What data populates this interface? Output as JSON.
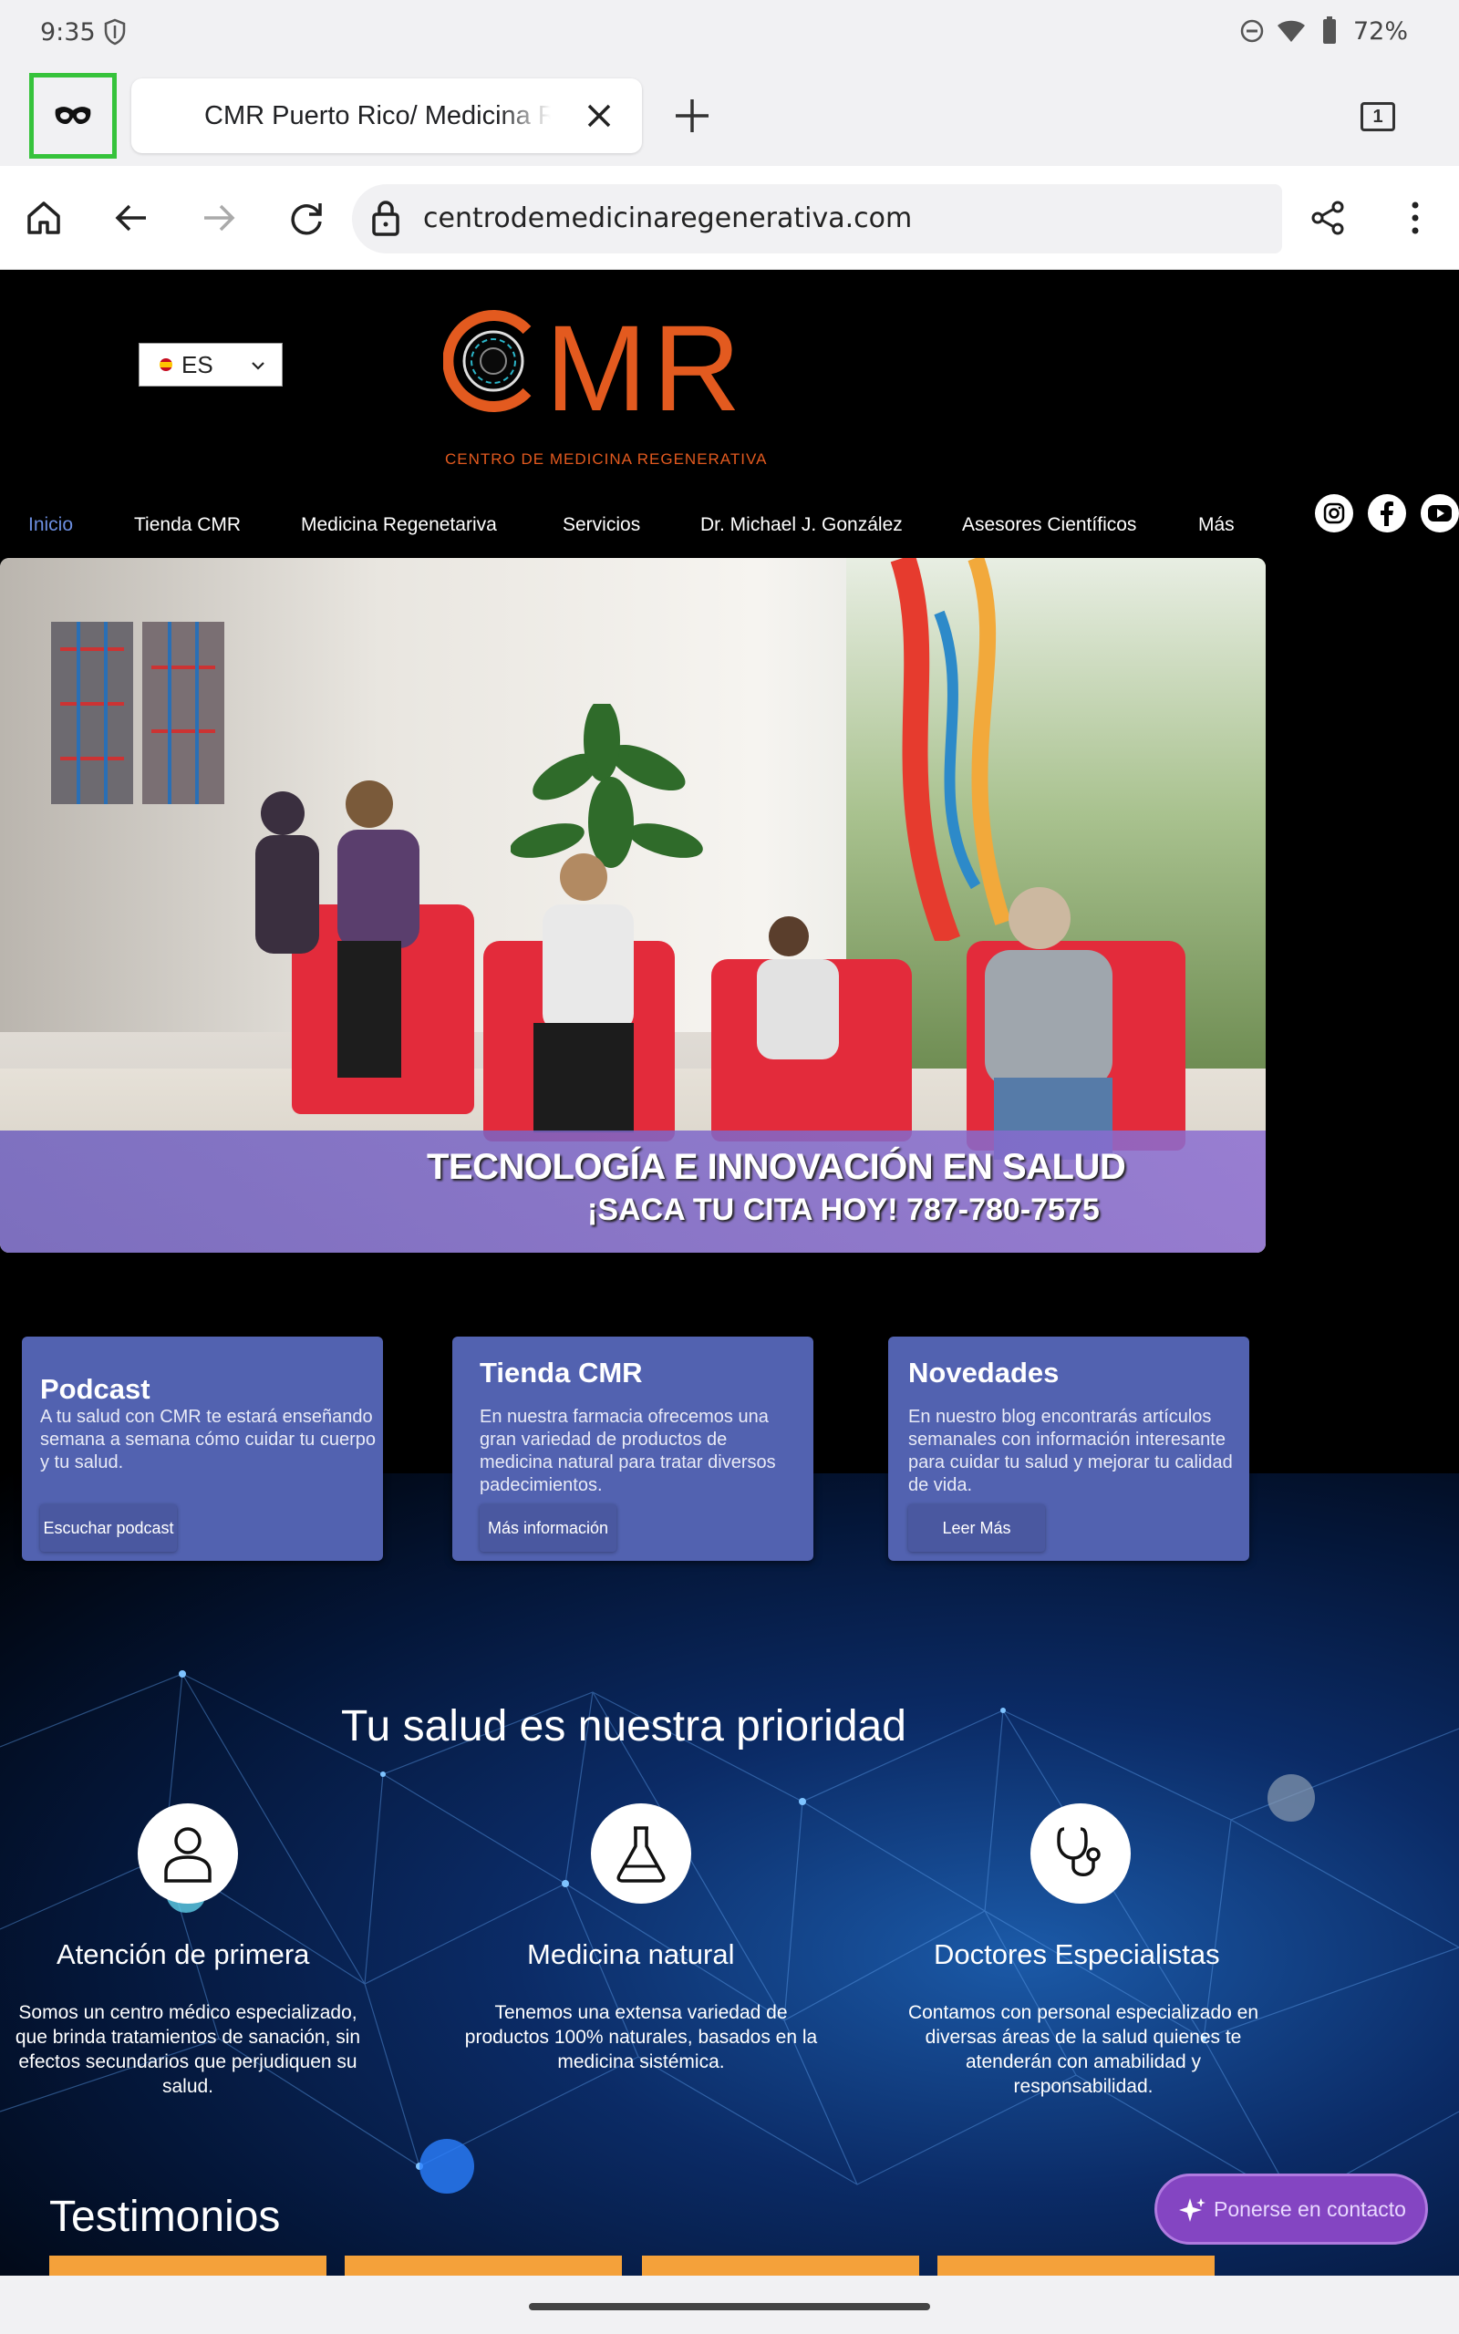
{
  "status": {
    "time": "9:35",
    "battery": "72%"
  },
  "browser": {
    "tab_title": "CMR Puerto Rico/ Medicina Regenerativa",
    "tab_count": "1",
    "url": "centrodemedicinaregenerativa.com"
  },
  "site": {
    "language": "ES",
    "logo_text": "MR",
    "logo_subtitle": "CENTRO DE MEDICINA REGENERATIVA",
    "nav": [
      "Inicio",
      "Tienda CMR",
      "Medicina Regenetariva",
      "Servicios",
      "Dr. Michael J. González",
      "Asesores Científicos",
      "Más"
    ],
    "hero": {
      "caption_line1": "TECNOLOGÍA E INNOVACIÓN EN SALUD",
      "caption_line2": "¡SACA TU CITA HOY!  787-780-7575"
    },
    "cards": [
      {
        "title": "Podcast",
        "desc": "A tu salud con CMR te estará enseñando semana a semana cómo cuidar tu cuerpo y tu salud.",
        "button": "Escuchar podcast"
      },
      {
        "title": "Tienda CMR",
        "desc": "En nuestra farmacia ofrecemos una gran variedad de productos de medicina natural para tratar diversos padecimientos.",
        "button": "Más información"
      },
      {
        "title": "Novedades",
        "desc": "En nuestro blog encontrarás artículos semanales con información interesante para cuidar tu salud y mejorar tu calidad de vida.",
        "button": "Leer Más"
      }
    ],
    "priority_heading": "Tu salud es nuestra prioridad",
    "features": [
      {
        "title": "Atención de primera",
        "desc": "Somos un centro médico especializado, que brinda tratamientos de sanación, sin efectos secundarios que perjudiquen su salud.",
        "icon": "person-icon"
      },
      {
        "title": "Medicina natural",
        "desc": "Tenemos una extensa variedad de productos 100% naturales, basados en la medicina sistémica.",
        "icon": "flask-icon"
      },
      {
        "title": "Doctores Especialistas",
        "desc": "Contamos con personal especializado en diversas áreas de la salud quienes te atenderán con amabilidad y responsabilidad.",
        "icon": "stethoscope-icon"
      }
    ],
    "testimonials_heading": "Testimonios",
    "contact_button": "Ponerse en contacto"
  },
  "colors": {
    "brand_orange": "#e35a1f",
    "card_blue": "#5262b0",
    "nav_active": "#6c8ee0",
    "incognito_highlight": "#36c33b",
    "contact_purple": "#8445c2"
  }
}
